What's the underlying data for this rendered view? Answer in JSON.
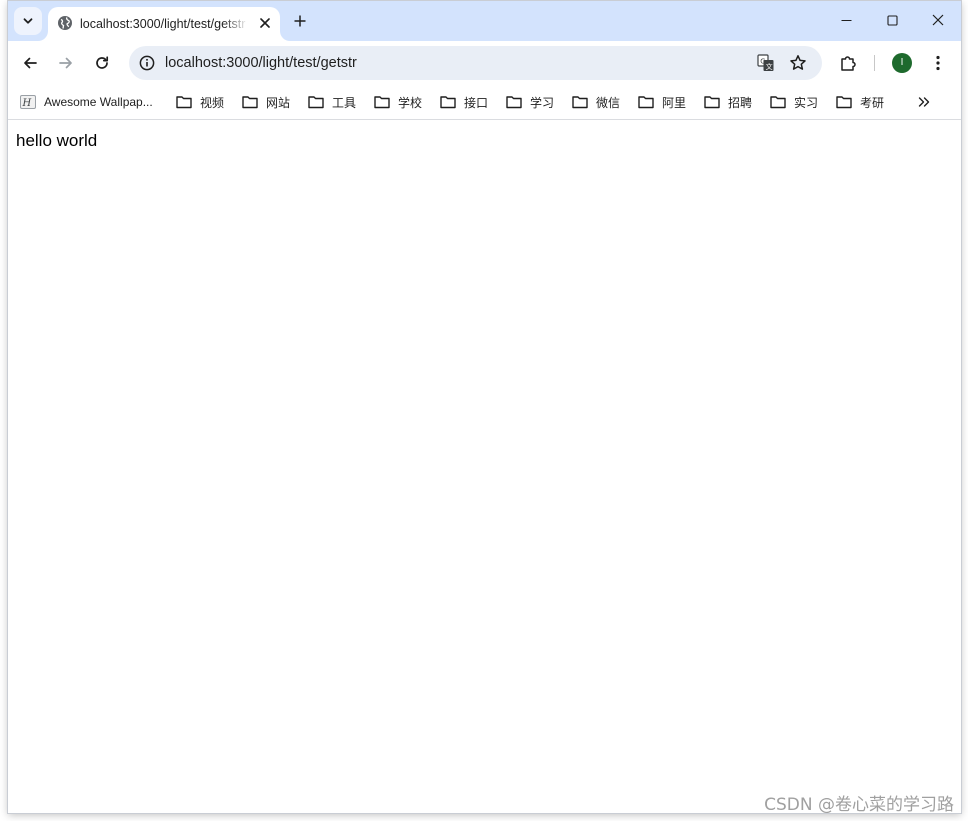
{
  "tab": {
    "title": "localhost:3000/light/test/getstr",
    "favicon": "globe-icon"
  },
  "window_controls": [
    "minimize-icon",
    "maximize-icon",
    "close-icon"
  ],
  "address_bar": {
    "url": "localhost:3000/light/test/getstr",
    "site_info_icon": "info-icon"
  },
  "profile": {
    "initial": "I",
    "color": "#1e6a2d"
  },
  "bookmarks": [
    {
      "label": "Awesome Wallpap...",
      "icon": "site-favicon"
    },
    {
      "label": "视频",
      "icon": "folder-icon"
    },
    {
      "label": "网站",
      "icon": "folder-icon"
    },
    {
      "label": "工具",
      "icon": "folder-icon"
    },
    {
      "label": "学校",
      "icon": "folder-icon"
    },
    {
      "label": "接口",
      "icon": "folder-icon"
    },
    {
      "label": "学习",
      "icon": "folder-icon"
    },
    {
      "label": "微信",
      "icon": "folder-icon"
    },
    {
      "label": "阿里",
      "icon": "folder-icon"
    },
    {
      "label": "招聘",
      "icon": "folder-icon"
    },
    {
      "label": "实习",
      "icon": "folder-icon"
    },
    {
      "label": "考研",
      "icon": "folder-icon"
    }
  ],
  "page": {
    "body_text": "hello world"
  },
  "watermark": "CSDN @卷心菜的学习路"
}
